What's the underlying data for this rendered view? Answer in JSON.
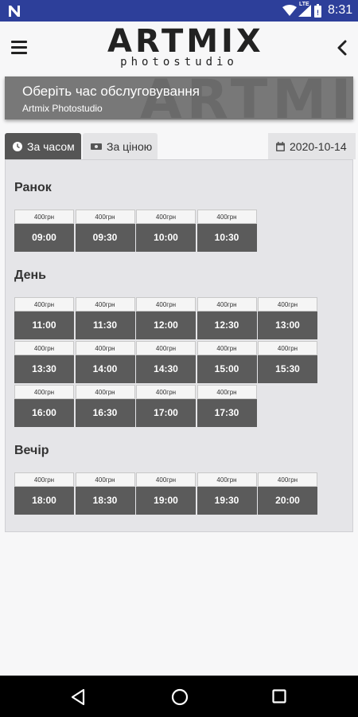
{
  "status_bar": {
    "time": "8:31",
    "network": "LTE"
  },
  "header": {
    "logo_main": "ARTMIX",
    "logo_sub": "photostudio",
    "watermark": "ARTMIX"
  },
  "banner": {
    "title": "Оберіть час обслуговування",
    "subtitle": "Artmix Photostudio"
  },
  "tabs": [
    {
      "label": "За часом",
      "active": true
    },
    {
      "label": "За ціною",
      "active": false
    }
  ],
  "date": "2020-10-14",
  "colors": {
    "status_bar": "#2d3f9a",
    "active_tab": "#555555",
    "slot_time": "#5b5b5b",
    "panel": "#e5e5e8"
  },
  "sections": [
    {
      "title": "Ранок",
      "slots": [
        {
          "price": "400грн",
          "time": "09:00"
        },
        {
          "price": "400грн",
          "time": "09:30"
        },
        {
          "price": "400грн",
          "time": "10:00"
        },
        {
          "price": "400грн",
          "time": "10:30"
        }
      ]
    },
    {
      "title": "День",
      "slots": [
        {
          "price": "400грн",
          "time": "11:00"
        },
        {
          "price": "400грн",
          "time": "11:30"
        },
        {
          "price": "400грн",
          "time": "12:00"
        },
        {
          "price": "400грн",
          "time": "12:30"
        },
        {
          "price": "400грн",
          "time": "13:00"
        },
        {
          "price": "400грн",
          "time": "13:30"
        },
        {
          "price": "400грн",
          "time": "14:00"
        },
        {
          "price": "400грн",
          "time": "14:30"
        },
        {
          "price": "400грн",
          "time": "15:00"
        },
        {
          "price": "400грн",
          "time": "15:30"
        },
        {
          "price": "400грн",
          "time": "16:00"
        },
        {
          "price": "400грн",
          "time": "16:30"
        },
        {
          "price": "400грн",
          "time": "17:00"
        },
        {
          "price": "400грн",
          "time": "17:30"
        }
      ]
    },
    {
      "title": "Вечір",
      "slots": [
        {
          "price": "400грн",
          "time": "18:00"
        },
        {
          "price": "400грн",
          "time": "18:30"
        },
        {
          "price": "400грн",
          "time": "19:00"
        },
        {
          "price": "400грн",
          "time": "19:30"
        },
        {
          "price": "400грн",
          "time": "20:00"
        }
      ]
    }
  ],
  "icons": {
    "status": [
      "n-notification-icon",
      "wifi-icon",
      "signal-icon",
      "battery-icon"
    ],
    "header": [
      "menu-icon",
      "back-chevron-icon"
    ],
    "tabs": [
      "clock-icon",
      "banknote-icon",
      "calendar-icon"
    ],
    "nav": [
      "nav-back-icon",
      "nav-home-icon",
      "nav-recent-icon"
    ]
  }
}
